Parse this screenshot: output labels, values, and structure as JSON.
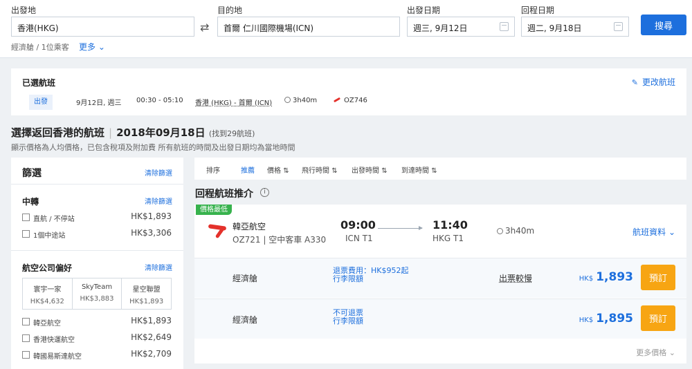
{
  "search": {
    "origin_label": "出發地",
    "origin_value": "香港(HKG)",
    "dest_label": "目的地",
    "dest_value": "首爾 仁川國際機場(ICN)",
    "depart_label": "出發日期",
    "depart_value": "週三, 9月12日",
    "return_label": "回程日期",
    "return_value": "週二, 9月18日",
    "search_button": "搜尋",
    "cabin_passengers": "經濟艙 / 1位乘客",
    "more_label": "更多",
    "swap_icon": "⇄",
    "chevron_icon": "⌄"
  },
  "selected": {
    "title": "已選航班",
    "change_label": "更改航班",
    "pencil_icon": "✎",
    "tag": "出發",
    "date": "9月12日, 週三",
    "time": "00:30 - 05:10",
    "route": "香港 (HKG) - 首爾 (ICN)",
    "duration": "3h40m",
    "flight": "OZ746"
  },
  "heading": {
    "title": "選擇返回香港的航班",
    "date": "2018年09月18日",
    "count": "(找到29航班)",
    "subnote": "顯示價格為人均價格，已包含稅項及附加費 所有航班的時間及出發日期均為當地時間"
  },
  "filters": {
    "title": "篩選",
    "clear_all": "清除篩選",
    "stops_title": "中轉",
    "stops_clear": "清除篩選",
    "stops": [
      {
        "label": "直航 / 不停站",
        "price": "HK$1,893"
      },
      {
        "label": "1個中途站",
        "price": "HK$3,306"
      }
    ],
    "airline_title": "航空公司偏好",
    "airline_clear": "清除篩選",
    "alliances": [
      {
        "name": "寰宇一家",
        "price": "HK$4,632"
      },
      {
        "name": "SkyTeam",
        "price": "HK$3,883"
      },
      {
        "name": "星空聯盟",
        "price": "HK$1,893"
      }
    ],
    "airlines": [
      {
        "label": "韓亞航空",
        "price": "HK$1,893"
      },
      {
        "label": "香港快運航空",
        "price": "HK$2,649"
      },
      {
        "label": "韓國易斯達航空",
        "price": "HK$2,709"
      }
    ]
  },
  "sort": {
    "label": "排序",
    "items": [
      "推薦",
      "價格",
      "飛行時間",
      "出發時間",
      "到達時間"
    ],
    "arrow_icon": "⇅"
  },
  "recommend": {
    "title": "回程航班推介",
    "info_icon": "i"
  },
  "flight": {
    "badge": "價格最低",
    "airline": "韓亞航空",
    "sub": "OZ721 | 空中客車 A330...",
    "dep_time": "09:00",
    "dep_code": "ICN T1",
    "arr_time": "11:40",
    "arr_code": "HKG T1",
    "duration": "3h40m",
    "details": "航班資料",
    "fares": [
      {
        "cabin": "經濟艙",
        "note1": "退票費用：HK$952起",
        "note2": "行李限額",
        "slow": "出票較慢",
        "currency": "HK$",
        "amount": "1,893",
        "book": "預訂"
      },
      {
        "cabin": "經濟艙",
        "note1": "不可退票",
        "note2": "行李限額",
        "slow": "",
        "currency": "HK$",
        "amount": "1,895",
        "book": "預訂"
      }
    ],
    "more_prices": "更多價格"
  },
  "colors": {
    "accent": "#1d6fdd",
    "book": "#f7a513",
    "badge": "#37b24d",
    "airline_red": "#e4312b"
  }
}
